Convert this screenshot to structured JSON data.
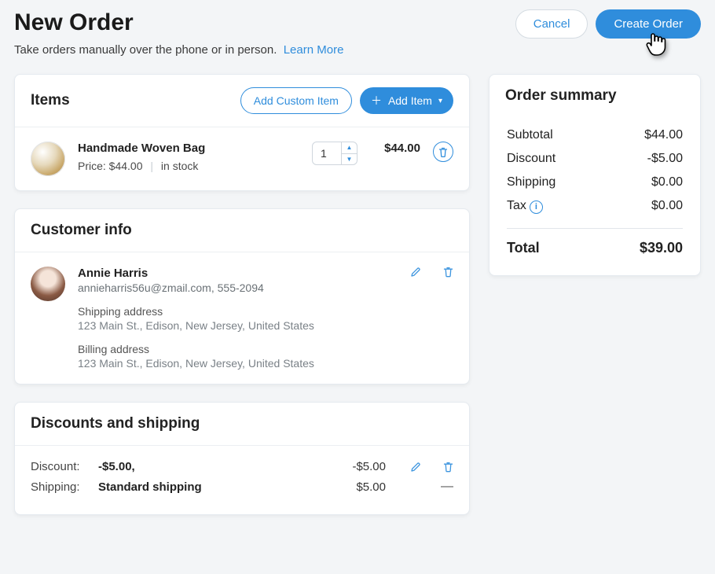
{
  "header": {
    "title": "New Order",
    "subtitle": "Take orders manually over the phone or in person.",
    "learn_more": "Learn More",
    "cancel": "Cancel",
    "create": "Create Order"
  },
  "items": {
    "title": "Items",
    "add_custom": "Add Custom Item",
    "add_item": "Add Item",
    "list": [
      {
        "name": "Handmade Woven Bag",
        "price_label": "Price: $44.00",
        "stock": "in stock",
        "qty": "1",
        "line_total": "$44.00"
      }
    ]
  },
  "customer": {
    "title": "Customer info",
    "name": "Annie Harris",
    "contact": "annieharris56u@zmail.com, 555-2094",
    "shipping_label": "Shipping address",
    "shipping_address": "123 Main St., Edison, New Jersey, United States",
    "billing_label": "Billing address",
    "billing_address": "123 Main St., Edison, New Jersey, United States"
  },
  "ds": {
    "title": "Discounts and shipping",
    "discount_label": "Discount:",
    "discount_value": "-$5.00,",
    "discount_amount": "-$5.00",
    "shipping_label": "Shipping:",
    "shipping_value": "Standard shipping",
    "shipping_amount": "$5.00"
  },
  "summary": {
    "title": "Order summary",
    "subtotal_label": "Subtotal",
    "subtotal": "$44.00",
    "discount_label": "Discount",
    "discount": "-$5.00",
    "shipping_label": "Shipping",
    "shipping": "$0.00",
    "tax_label": "Tax",
    "tax": "$0.00",
    "total_label": "Total",
    "total": "$39.00"
  }
}
